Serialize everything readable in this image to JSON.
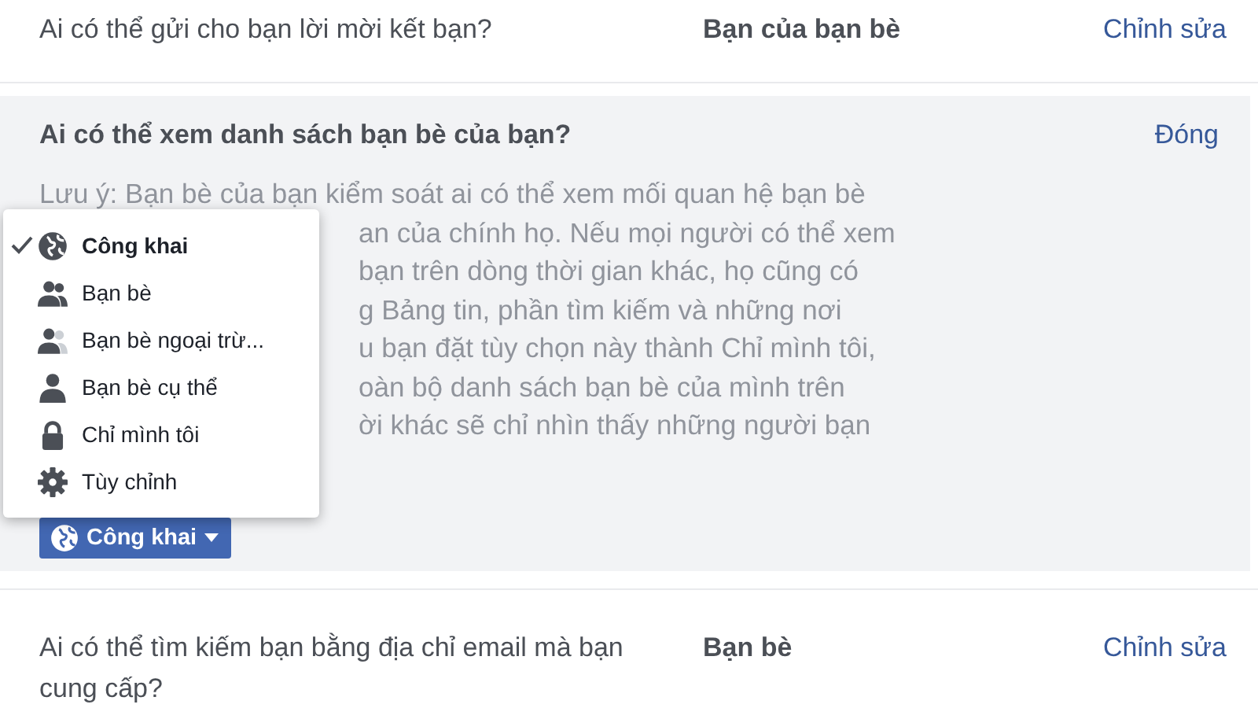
{
  "rows_top": [
    {
      "question": "Ai có thể gửi cho bạn lời mời kết bạn?",
      "value": "Bạn của bạn bè",
      "action": "Chỉnh sửa"
    }
  ],
  "expanded": {
    "question": "Ai có thể xem danh sách bạn bè của bạn?",
    "close": "Đóng",
    "note_lines": [
      "Lưu ý: Bạn bè của bạn kiểm soát ai có thể xem mối quan hệ bạn bè",
      "an của chính họ. Nếu mọi người có thể xem",
      "bạn trên dòng thời gian khác, họ cũng có",
      "g Bảng tin, phần tìm kiếm và những nơi",
      "u bạn đặt tùy chọn này thành Chỉ mình tôi,",
      "oàn bộ danh sách bạn bè của mình trên",
      "ời khác sẽ chỉ nhìn thấy những người bạn"
    ],
    "menu": [
      {
        "label": "Công khai",
        "kind": "globe",
        "selected": true
      },
      {
        "label": "Bạn bè",
        "kind": "friends",
        "selected": false
      },
      {
        "label": "Bạn bè ngoại trừ...",
        "kind": "except",
        "selected": false
      },
      {
        "label": "Bạn bè cụ thể",
        "kind": "person",
        "selected": false
      },
      {
        "label": "Chỉ mình tôi",
        "kind": "lock",
        "selected": false
      },
      {
        "label": "Tùy chỉnh",
        "kind": "gear",
        "selected": false
      }
    ],
    "button": {
      "label": "Công khai"
    }
  },
  "rows_bottom": [
    {
      "question": "Ai có thể tìm kiếm bạn bằng địa chỉ email mà bạn cung cấp?",
      "value": "Bạn bè",
      "action": "Chỉnh sửa"
    }
  ]
}
